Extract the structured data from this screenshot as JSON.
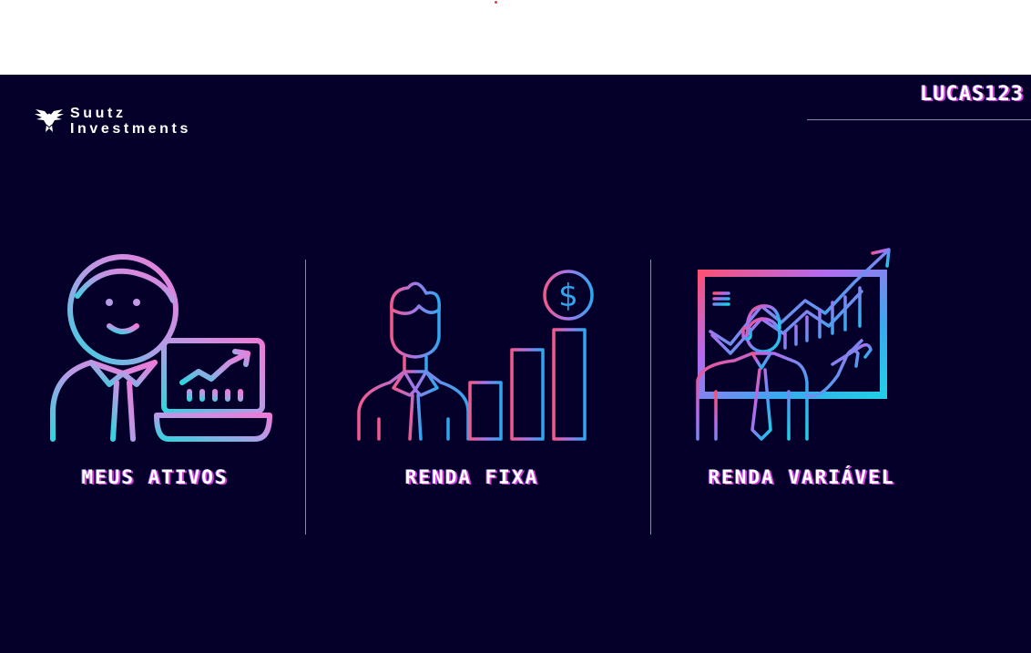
{
  "brand": {
    "line1": "Suutz",
    "line2": "Investments",
    "logo_icon": "eagle-icon"
  },
  "user": {
    "name": "LUCAS123"
  },
  "colors": {
    "background": "#05002a",
    "gradient_pink": "#ff5fa0",
    "gradient_purple": "#a970ff",
    "gradient_cyan": "#1fd2e6",
    "label_glow": "#d23bd8"
  },
  "cards": [
    {
      "label": "MEUS ATIVOS",
      "icon": "investor-laptop-icon"
    },
    {
      "label": "RENDA FIXA",
      "icon": "fixed-income-growth-icon"
    },
    {
      "label": "RENDA VARIÁVEL",
      "icon": "variable-income-presentation-icon"
    }
  ]
}
